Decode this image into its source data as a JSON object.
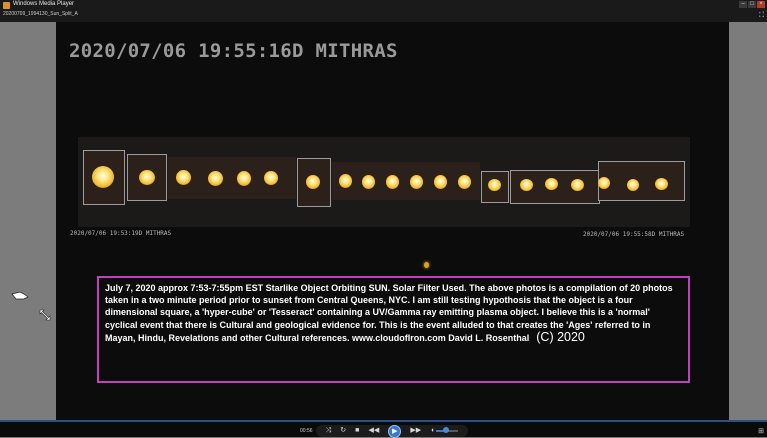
{
  "window": {
    "app_title": "Windows Media Player",
    "file_title": "20200709_1994130_Sun_Split_A"
  },
  "video": {
    "big_stamp": "2020/07/06 19:55:16D MITHRAS",
    "stamp_left": "2020/07/06 19:53:19D MITHRAS",
    "stamp_right": "2020/07/06 19:55:58D MITHRAS",
    "caption": "July 7, 2020 approx 7:53-7:55pm EST Starlike Object Orbiting SUN. Solar Filter Used. The above photos is a compilation of 20 photos taken in a two minute period prior to sunset from Central Queens, NYC. I am still testing hypothosis that the object is a four dimensional square, a 'hyper-cube' or 'Tesseract' containing a UV/Gamma ray emitting plasma object. I believe this is a 'normal' cyclical event that there is Cultural and geological evidence for. This is the event alluded to that creates the 'Ages' referred to in Mayan, Hindu, Revelations and other Cultural references. www.cloudofIron.com David L. Rosenthal",
    "copyright": "(C) 2020"
  },
  "controls": {
    "time": "00:56",
    "volume_fraction": 0.45,
    "icons": [
      "shuffle-icon",
      "repeat-icon",
      "stop-icon",
      "previous-icon",
      "play-icon",
      "next-icon",
      "mute-icon",
      "volume-slider"
    ]
  },
  "colors": {
    "caption_border": "#c040c0",
    "accent": "#3a78c8"
  }
}
